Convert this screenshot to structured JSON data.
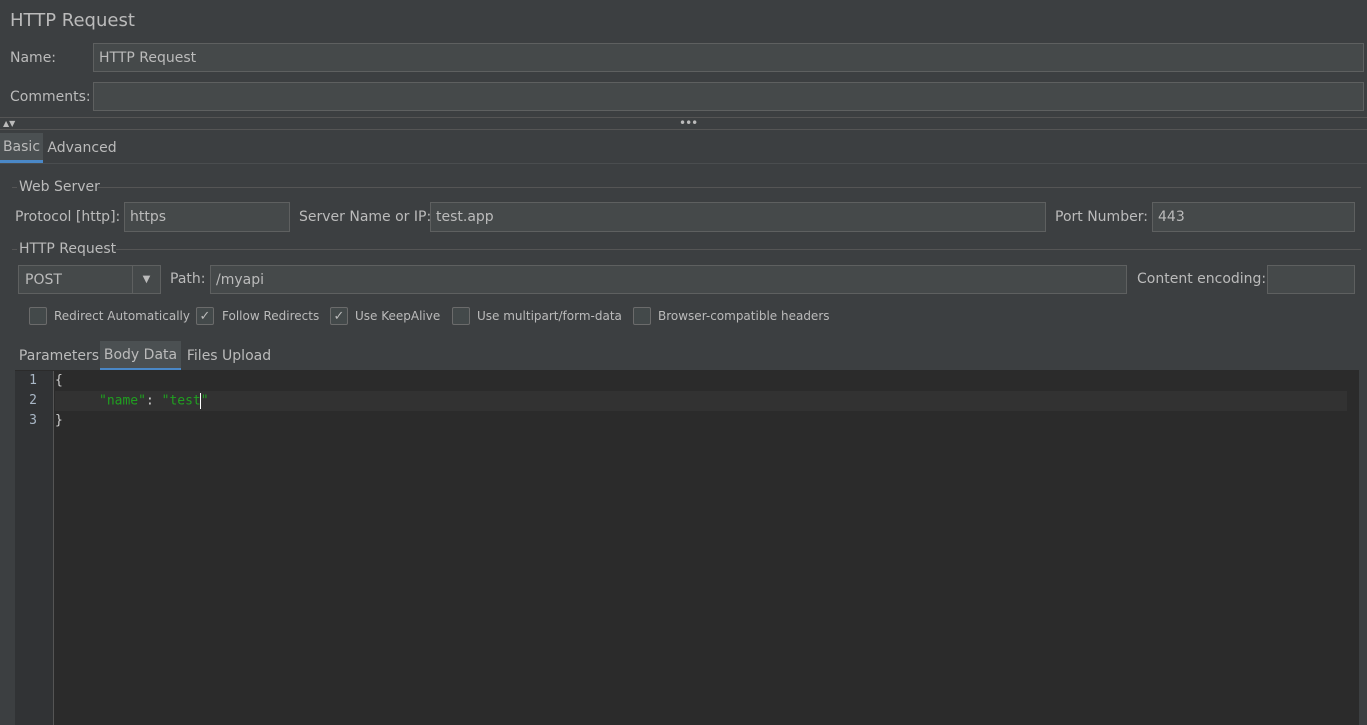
{
  "panel": {
    "title": "HTTP Request",
    "name_label": "Name:",
    "name_value": "HTTP Request",
    "comments_label": "Comments:",
    "comments_value": ""
  },
  "tabs": {
    "top": [
      "Basic",
      "Advanced"
    ],
    "active_top": "Basic",
    "sub": [
      "Parameters",
      "Body Data",
      "Files Upload"
    ],
    "active_sub": "Body Data"
  },
  "web_server": {
    "group_title": "Web Server",
    "protocol_label": "Protocol [http]:",
    "protocol_value": "https",
    "server_label": "Server Name or IP:",
    "server_value": "test.app",
    "port_label": "Port Number:",
    "port_value": "443"
  },
  "http_request": {
    "group_title": "HTTP Request",
    "method_value": "POST",
    "path_label": "Path:",
    "path_value": "/myapi",
    "encoding_label": "Content encoding:",
    "encoding_value": ""
  },
  "options": [
    {
      "label": "Redirect Automatically",
      "checked": false
    },
    {
      "label": "Follow Redirects",
      "checked": true
    },
    {
      "label": "Use KeepAlive",
      "checked": true
    },
    {
      "label": "Use multipart/form-data",
      "checked": false
    },
    {
      "label": "Browser-compatible headers",
      "checked": false
    }
  ],
  "body": {
    "line_numbers": [
      "1",
      "2",
      "3"
    ],
    "line1": "{",
    "line2_key": "\"name\"",
    "line2_sep": ": ",
    "line2_val": "\"test",
    "line2_end": "\"",
    "line3": "}"
  },
  "colors": {
    "background": "#3c3f41",
    "editor_bg": "#2b2b2b",
    "accent": "#4a88c7",
    "string": "#20a020"
  }
}
